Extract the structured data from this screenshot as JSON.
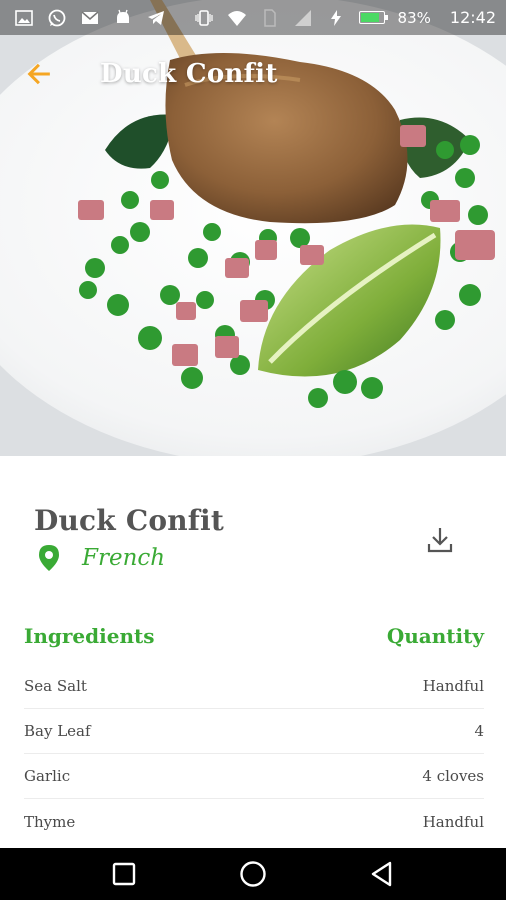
{
  "status_bar": {
    "battery_percent": "83%",
    "battery_level": 0.83,
    "time": "12:42",
    "left_icons": [
      "image-icon",
      "whatsapp-icon",
      "mail-icon",
      "android-icon",
      "telegram-icon"
    ],
    "right_icons": [
      "vibrate-icon",
      "wifi-icon",
      "no-sim-icon",
      "signal-icon",
      "charging-icon"
    ]
  },
  "app_bar": {
    "title": "Duck Confit",
    "back_icon": "arrow-left-icon",
    "accent": "#f5a623"
  },
  "recipe": {
    "title": "Duck Confit",
    "cuisine": "French",
    "location_icon": "location-pin-icon",
    "download_icon": "download-icon",
    "accent_color": "#3aaa35"
  },
  "ingredients": {
    "header_left": "Ingredients",
    "header_right": "Quantity",
    "items": [
      {
        "name": "Sea Salt",
        "quantity": "Handful"
      },
      {
        "name": "Bay Leaf",
        "quantity": "4"
      },
      {
        "name": "Garlic",
        "quantity": "4 cloves"
      },
      {
        "name": "Thyme",
        "quantity": "Handful"
      }
    ]
  },
  "nav_bar": {
    "icons": [
      "recents-square-icon",
      "home-circle-icon",
      "back-triangle-icon"
    ]
  }
}
